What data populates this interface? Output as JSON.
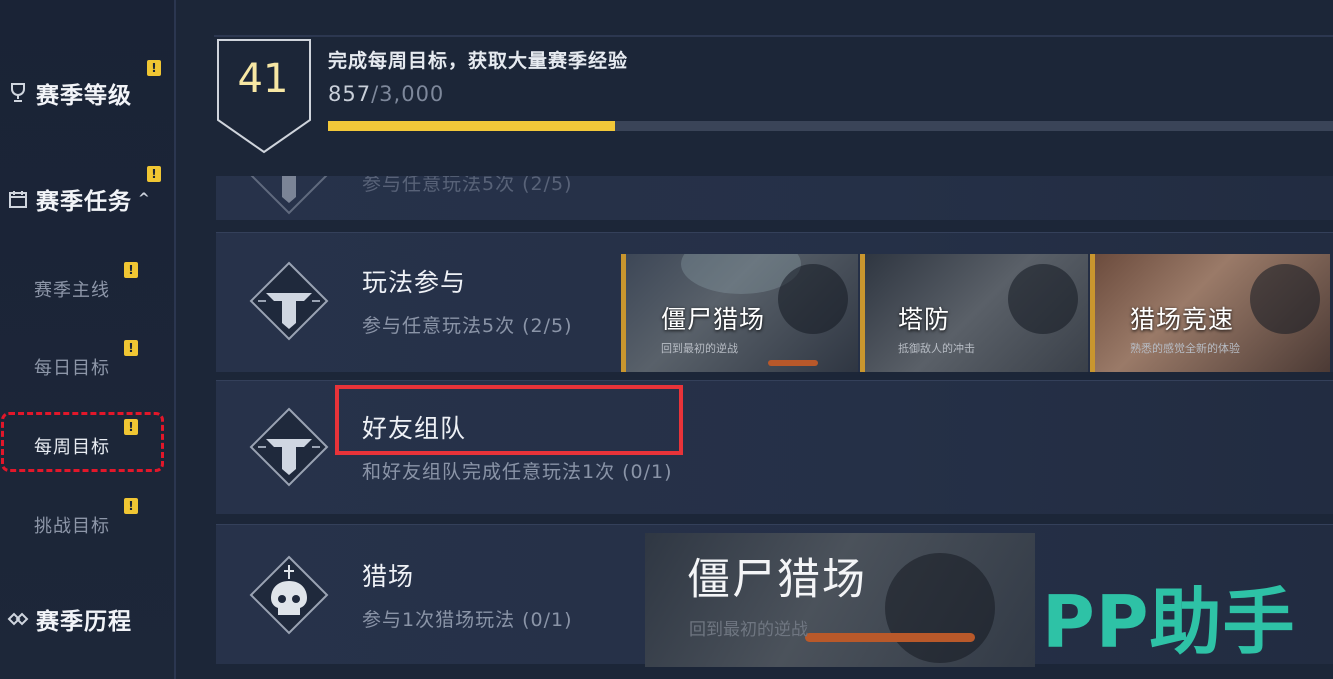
{
  "sidebar": {
    "season_level": "赛季等级",
    "season_tasks": "赛季任务",
    "season_history": "赛季历程",
    "sub_items": [
      {
        "label": "赛季主线"
      },
      {
        "label": "每日目标"
      },
      {
        "label": "每周目标"
      },
      {
        "label": "挑战目标"
      }
    ],
    "badge_symbol": "!",
    "expand_chevron": "^"
  },
  "header": {
    "level": "41",
    "goal": "完成每周目标，获取大量赛季经验",
    "progress_current": "857",
    "progress_total": "/3,000",
    "progress_fraction": 0.2857
  },
  "tasks": [
    {
      "title": "",
      "desc": "参与任意玩法5次 (2/5)",
      "icon": "team-emblem-icon"
    },
    {
      "title": "玩法参与",
      "desc": "参与任意玩法5次 (2/5)",
      "icon": "team-emblem-icon"
    },
    {
      "title": "好友组队",
      "desc": "和好友组队完成任意玩法1次 (0/1)",
      "icon": "team-emblem-icon"
    },
    {
      "title": "猎场",
      "desc": "参与1次猎场玩法 (0/1)",
      "icon": "skull-emblem-icon"
    }
  ],
  "modes": [
    {
      "name": "僵尸猎场",
      "sub": "回到最初的逆战"
    },
    {
      "name": "塔防",
      "sub": "抵御敌人的冲击"
    },
    {
      "name": "猎场竞速",
      "sub": "熟悉的感觉全新的体验"
    }
  ],
  "featured_mode": {
    "name": "僵尸猎场",
    "sub": "回到最初的逆战"
  },
  "watermark": "PP助手",
  "colors": {
    "accent_yellow": "#f2c839",
    "highlight_red": "#e83339",
    "watermark_green": "#2ec2a6",
    "background": "#1c2638"
  }
}
